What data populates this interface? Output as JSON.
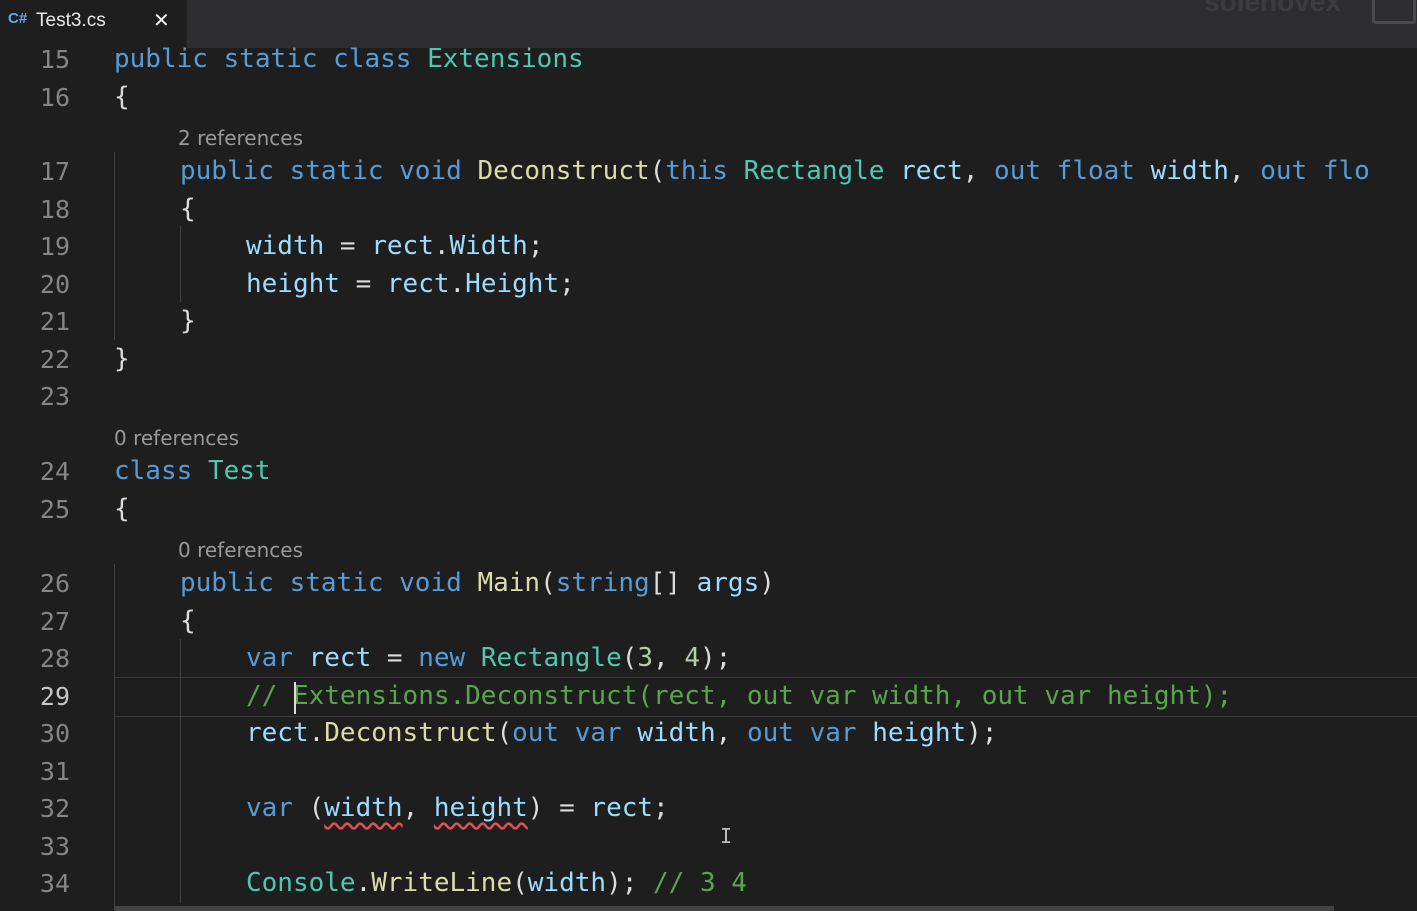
{
  "tab": {
    "icon": "C#",
    "label": "Test3.cs",
    "close": "✕"
  },
  "watermark": "solenovex",
  "line_numbers": [
    "15",
    "16",
    "17",
    "18",
    "19",
    "20",
    "21",
    "22",
    "23",
    "24",
    "25",
    "26",
    "27",
    "28",
    "29",
    "30",
    "31",
    "32",
    "33",
    "34"
  ],
  "active_line": "29",
  "codelens": {
    "deconstruct": "2 references",
    "test_class": "0 references",
    "main": "0 references"
  },
  "code": {
    "l15": [
      "public",
      " ",
      "static",
      " ",
      "class",
      " ",
      "Extensions"
    ],
    "l16": "{",
    "l17": [
      "public",
      " ",
      "static",
      " ",
      "void",
      " ",
      "Deconstruct",
      "(",
      "this",
      " ",
      "Rectangle",
      " ",
      "rect",
      ", ",
      "out",
      " ",
      "float",
      " ",
      "width",
      ", ",
      "out",
      " ",
      "flo"
    ],
    "l18": "{",
    "l19": [
      "width",
      " = ",
      "rect",
      ".",
      "Width",
      ";"
    ],
    "l20": [
      "height",
      " = ",
      "rect",
      ".",
      "Height",
      ";"
    ],
    "l21": "}",
    "l22": "}",
    "l24": [
      "class",
      " ",
      "Test"
    ],
    "l25": "{",
    "l26": [
      "public",
      " ",
      "static",
      " ",
      "void",
      " ",
      "Main",
      "(",
      "string",
      "[] ",
      "args",
      ")"
    ],
    "l27": "{",
    "l28": [
      "var",
      " ",
      "rect",
      " = ",
      "new",
      " ",
      "Rectangle",
      "(",
      "3",
      ", ",
      "4",
      ");"
    ],
    "l29": [
      "// ",
      "Extensions.Deconstruct(rect, out var width, out var height);"
    ],
    "l30": [
      "rect",
      ".",
      "Deconstruct",
      "(",
      "out",
      " ",
      "var",
      " ",
      "width",
      ", ",
      "out",
      " ",
      "var",
      " ",
      "height",
      ");"
    ],
    "l32": [
      "var",
      " (",
      "width",
      ", ",
      "height",
      ") = ",
      "rect",
      ";"
    ],
    "l34": [
      "Console",
      ".",
      "WriteLine",
      "(",
      "width",
      "); ",
      "// 3 4"
    ]
  },
  "colors": {
    "background": "#1e1e1e",
    "keyword": "#569cd6",
    "type": "#4ec9b0",
    "method": "#dcdcaa",
    "identifier": "#9cdcfe",
    "comment": "#57a64a"
  }
}
